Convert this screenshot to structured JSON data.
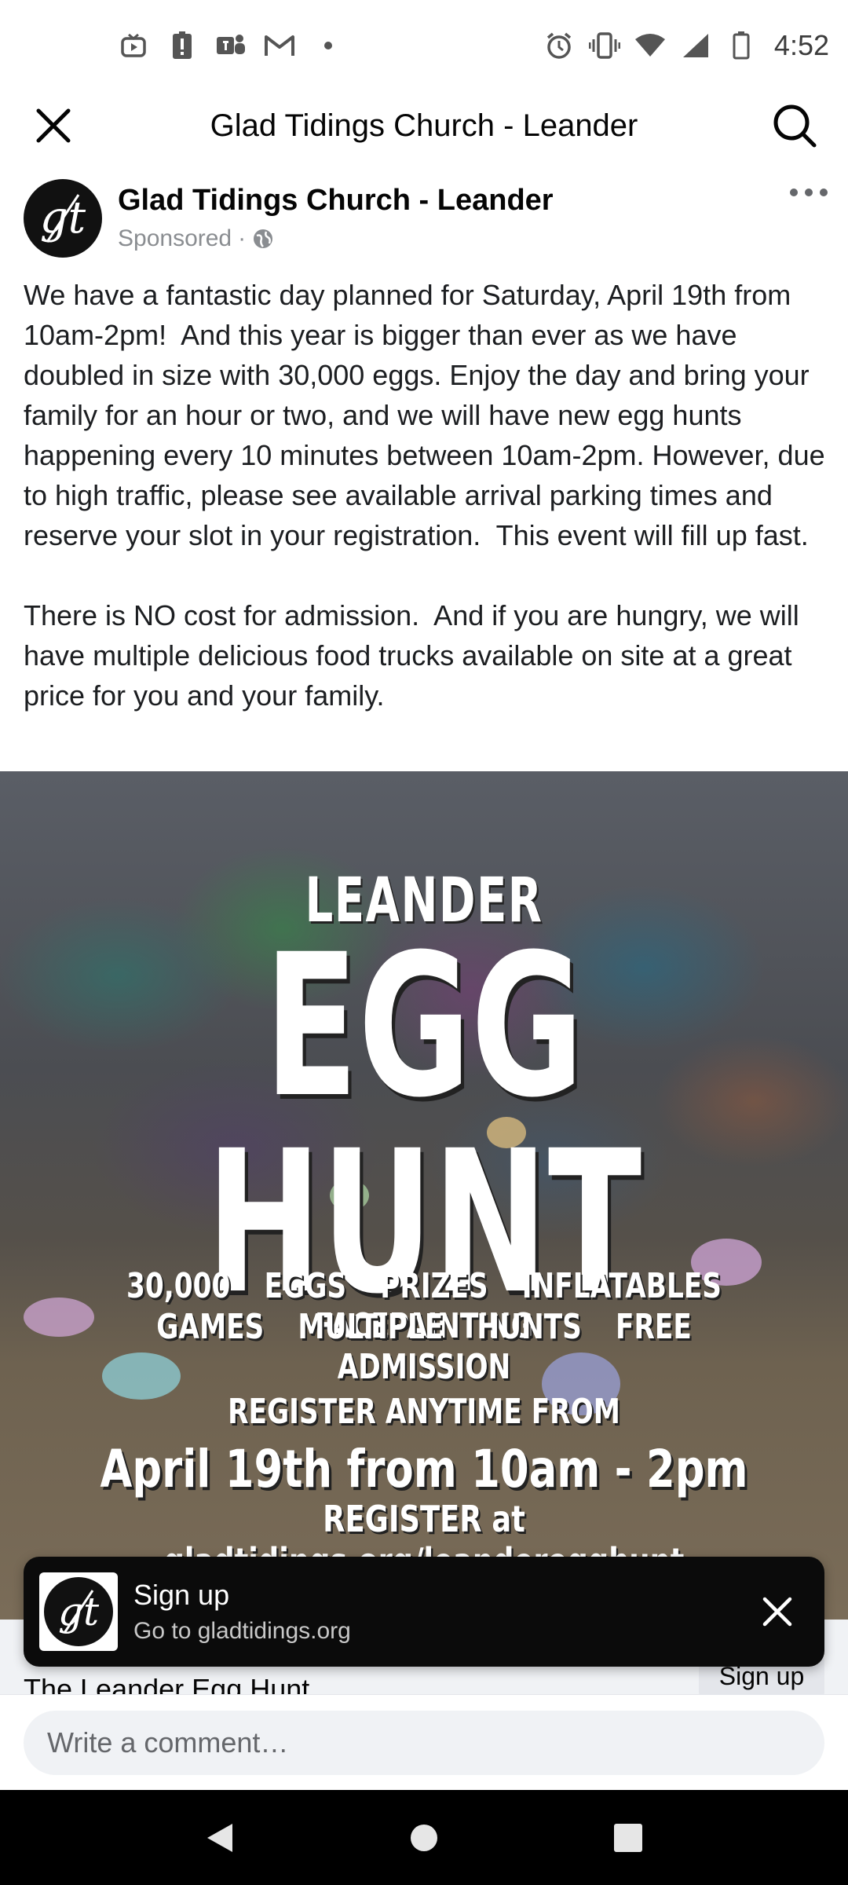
{
  "status_bar": {
    "time": "4:52",
    "left_icons": [
      "tv-icon",
      "alert-icon",
      "teams-icon",
      "gmail-icon",
      "dot-icon"
    ],
    "right_icons": [
      "alarm-icon",
      "vibrate-icon",
      "wifi-icon",
      "signal-icon",
      "battery-icon"
    ]
  },
  "header": {
    "title": "Glad Tidings Church - Leander"
  },
  "post": {
    "author": "Glad Tidings Church - Leander",
    "sponsored_label": "Sponsored",
    "separator": "·",
    "avatar_text": "gt",
    "body": "We have a fantastic day planned for Saturday, April 19th from 10am-2pm!  And this year is bigger than ever as we have doubled in size with 30,000 eggs. Enjoy the day and bring your family for an hour or two, and we will have new egg hunts happening every 10 minutes between 10am-2pm. However, due to high traffic, please see available arrival parking times and reserve your slot in your registration.  This event will fill up fast.\n\nThere is NO cost for admission.  And if you are hungry, we will have multiple delicious food trucks available on site at a great price for you and your family."
  },
  "ad": {
    "leander": "LEANDER",
    "headline": "EGG HUNT",
    "features_line1": "30,000 EGGS   PRIZES   INFLATABLES   FACEPAINTING",
    "features_line2": "GAMES   MULTIPLE HUNTS    FREE ADMISSION",
    "register_label": "REGISTER ANYTIME FROM",
    "date": "April 19th from 10am - 2pm",
    "url": "REGISTER at gladtidings.org/leanderegghunt"
  },
  "link_preview": {
    "title": "The Leander Egg Hunt",
    "cta": "Sign up"
  },
  "snackbar": {
    "title": "Sign up",
    "subtitle": "Go to gladtidings.org",
    "avatar_text": "gt"
  },
  "comment": {
    "placeholder": "Write a comment…"
  },
  "colors": {
    "text": "#1c1e21",
    "muted": "#8a8d91",
    "snackbar_bg": "#0b0b0b",
    "input_bg": "#f0f2f5"
  }
}
